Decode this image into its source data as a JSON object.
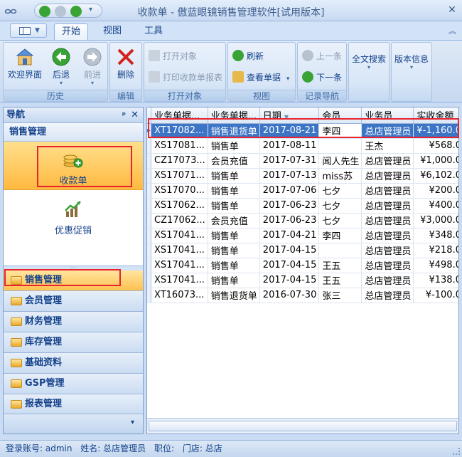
{
  "window": {
    "title": "收款单 - 傲蓝眼镜销售管理软件[试用版本]",
    "close_glyph": "✕"
  },
  "tabs": [
    {
      "label": "开始",
      "active": true
    },
    {
      "label": "视图",
      "active": false
    },
    {
      "label": "工具",
      "active": false
    }
  ],
  "ribbon": {
    "history": {
      "label": "历史",
      "welcome": "欢迎界面",
      "back": "后退",
      "forward": "前进"
    },
    "edit": {
      "label": "编辑",
      "delete": "删除"
    },
    "open": {
      "label": "打开对象",
      "open_object": "打开对象",
      "print_report": "打印收款单报表"
    },
    "view": {
      "label": "视图",
      "refresh": "刷新",
      "view_docs": "查看单据"
    },
    "nav": {
      "label": "记录导航",
      "prev": "上一条",
      "next": "下一条"
    },
    "search": {
      "full_text": "全文搜索"
    },
    "version": {
      "info": "版本信息"
    }
  },
  "nav": {
    "title": "导航",
    "pin_glyph": "ᵖ",
    "close_glyph": "✕",
    "section": "销售管理",
    "items": [
      {
        "label": "收款单",
        "selected": true
      },
      {
        "label": "优惠促销",
        "selected": false
      }
    ],
    "modules": [
      {
        "label": "销售管理",
        "active": true
      },
      {
        "label": "会员管理",
        "active": false
      },
      {
        "label": "财务管理",
        "active": false
      },
      {
        "label": "库存管理",
        "active": false
      },
      {
        "label": "基础资料",
        "active": false
      },
      {
        "label": "GSP管理",
        "active": false
      },
      {
        "label": "报表管理",
        "active": false
      }
    ]
  },
  "grid": {
    "columns": [
      "业务单据...",
      "业务单据...",
      "日期",
      "会员",
      "业务员",
      "实收金额"
    ],
    "rows": [
      [
        "XT17082...",
        "销售退货单",
        "2017-08-21",
        "李四",
        "总店管理员",
        "¥-1,160.00"
      ],
      [
        "XS17081...",
        "销售单",
        "2017-08-11",
        "",
        "王杰",
        "¥568.00"
      ],
      [
        "CZ17073...",
        "会员充值",
        "2017-07-31",
        "闻人先生",
        "总店管理员",
        "¥1,000.00"
      ],
      [
        "XS17071...",
        "销售单",
        "2017-07-13",
        "miss苏",
        "总店管理员",
        "¥6,102.00"
      ],
      [
        "XS17070...",
        "销售单",
        "2017-07-06",
        "七夕",
        "总店管理员",
        "¥200.00"
      ],
      [
        "XS17062...",
        "销售单",
        "2017-06-23",
        "七夕",
        "总店管理员",
        "¥400.00"
      ],
      [
        "CZ17062...",
        "会员充值",
        "2017-06-23",
        "七夕",
        "总店管理员",
        "¥3,000.00"
      ],
      [
        "XS17041...",
        "销售单",
        "2017-04-21",
        "李四",
        "总店管理员",
        "¥348.00"
      ],
      [
        "XS17041...",
        "销售单",
        "2017-04-15",
        "",
        "总店管理员",
        "¥218.00"
      ],
      [
        "XS17041...",
        "销售单",
        "2017-04-15",
        "王五",
        "总店管理员",
        "¥498.00"
      ],
      [
        "XS17041...",
        "销售单",
        "2017-04-15",
        "王五",
        "总店管理员",
        "¥138.00"
      ],
      [
        "XT16073...",
        "销售退货单",
        "2016-07-30",
        "张三",
        "总店管理员",
        "¥-100.00"
      ]
    ]
  },
  "status": {
    "account": "登录账号: admin",
    "name": "姓名: 总店管理员",
    "post": "职位:",
    "store": "门店: 总店"
  },
  "colors": {
    "selected_row": "#3c74c6",
    "selection_highlight": "#e8232f",
    "selected_nav": "#ffb93f"
  }
}
